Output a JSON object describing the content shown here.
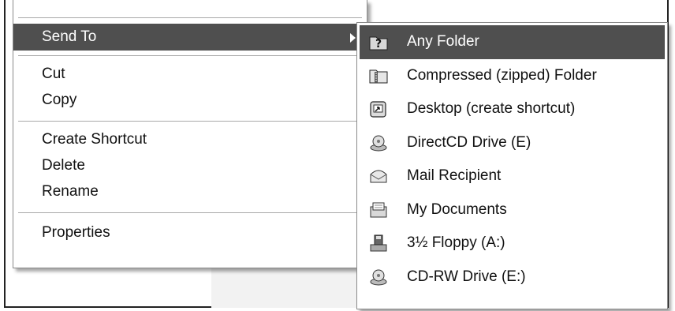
{
  "context_menu": {
    "send_to": "Send To",
    "cut": "Cut",
    "copy": "Copy",
    "create_shortcut": "Create Shortcut",
    "delete": "Delete",
    "rename": "Rename",
    "properties": "Properties"
  },
  "send_to_menu": {
    "items": [
      {
        "label": "Any Folder",
        "icon": "folder-question-icon"
      },
      {
        "label": "Compressed (zipped) Folder",
        "icon": "zipped-folder-icon"
      },
      {
        "label": "Desktop (create shortcut)",
        "icon": "desktop-shortcut-icon"
      },
      {
        "label": "DirectCD Drive (E)",
        "icon": "cd-drive-icon"
      },
      {
        "label": "Mail Recipient",
        "icon": "mail-icon"
      },
      {
        "label": "My Documents",
        "icon": "documents-icon"
      },
      {
        "label": "3½ Floppy (A:)",
        "icon": "floppy-icon"
      },
      {
        "label": "CD-RW Drive (E:)",
        "icon": "cd-rw-drive-icon"
      }
    ]
  },
  "colors": {
    "highlight": "#4f4f4f",
    "highlight_text": "#ffffff",
    "separator": "#a9a9a9"
  }
}
